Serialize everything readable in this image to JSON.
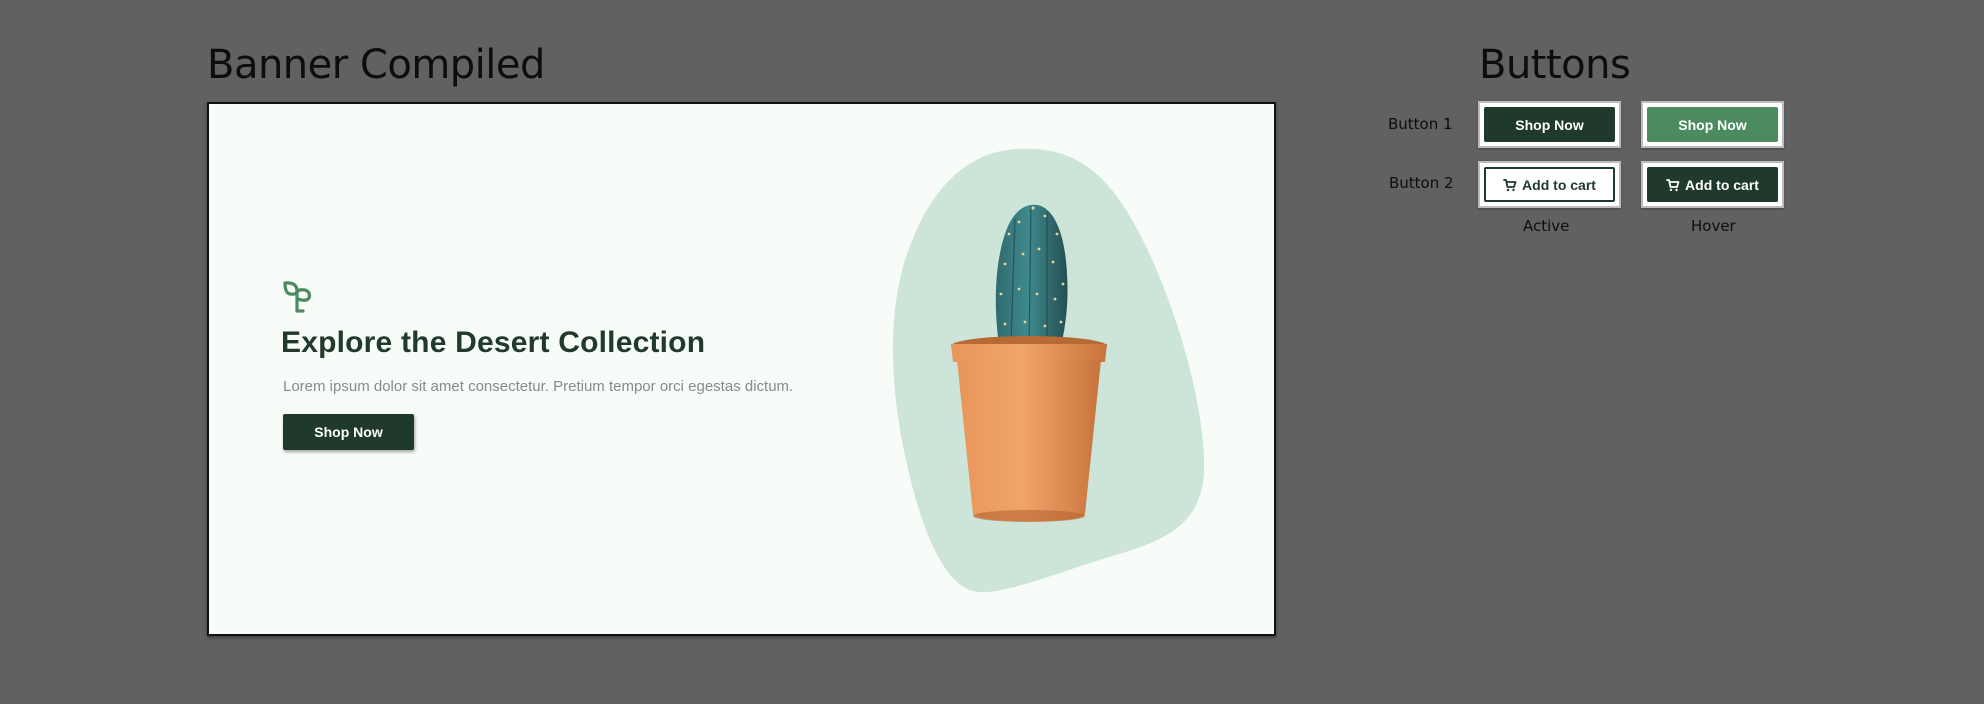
{
  "banner_section": {
    "title": "Banner Compiled",
    "banner": {
      "headline": "Explore the Desert Collection",
      "body": "Lorem ipsum dolor sit amet consectetur. Pretium tempor orci egestas dictum.",
      "cta_label": "Shop Now",
      "logo_icon": "sprout-icon",
      "image": "potted-cactus"
    }
  },
  "buttons_section": {
    "title": "Buttons",
    "rows": [
      {
        "label": "Button 1",
        "active_label": "Shop Now",
        "hover_label": "Shop Now"
      },
      {
        "label": "Button 2",
        "active_label": "Add to cart",
        "hover_label": "Add to cart",
        "icon": "cart-icon"
      }
    ],
    "states": {
      "active": "Active",
      "hover": "Hover"
    }
  },
  "colors": {
    "canvas": "#616161",
    "banner_bg": "#f7fcf8",
    "primary_dark": "#1f3a2b",
    "primary_hover": "#4c8a5f",
    "blob": "#cde5d9",
    "body_text": "#8a8a8a"
  }
}
